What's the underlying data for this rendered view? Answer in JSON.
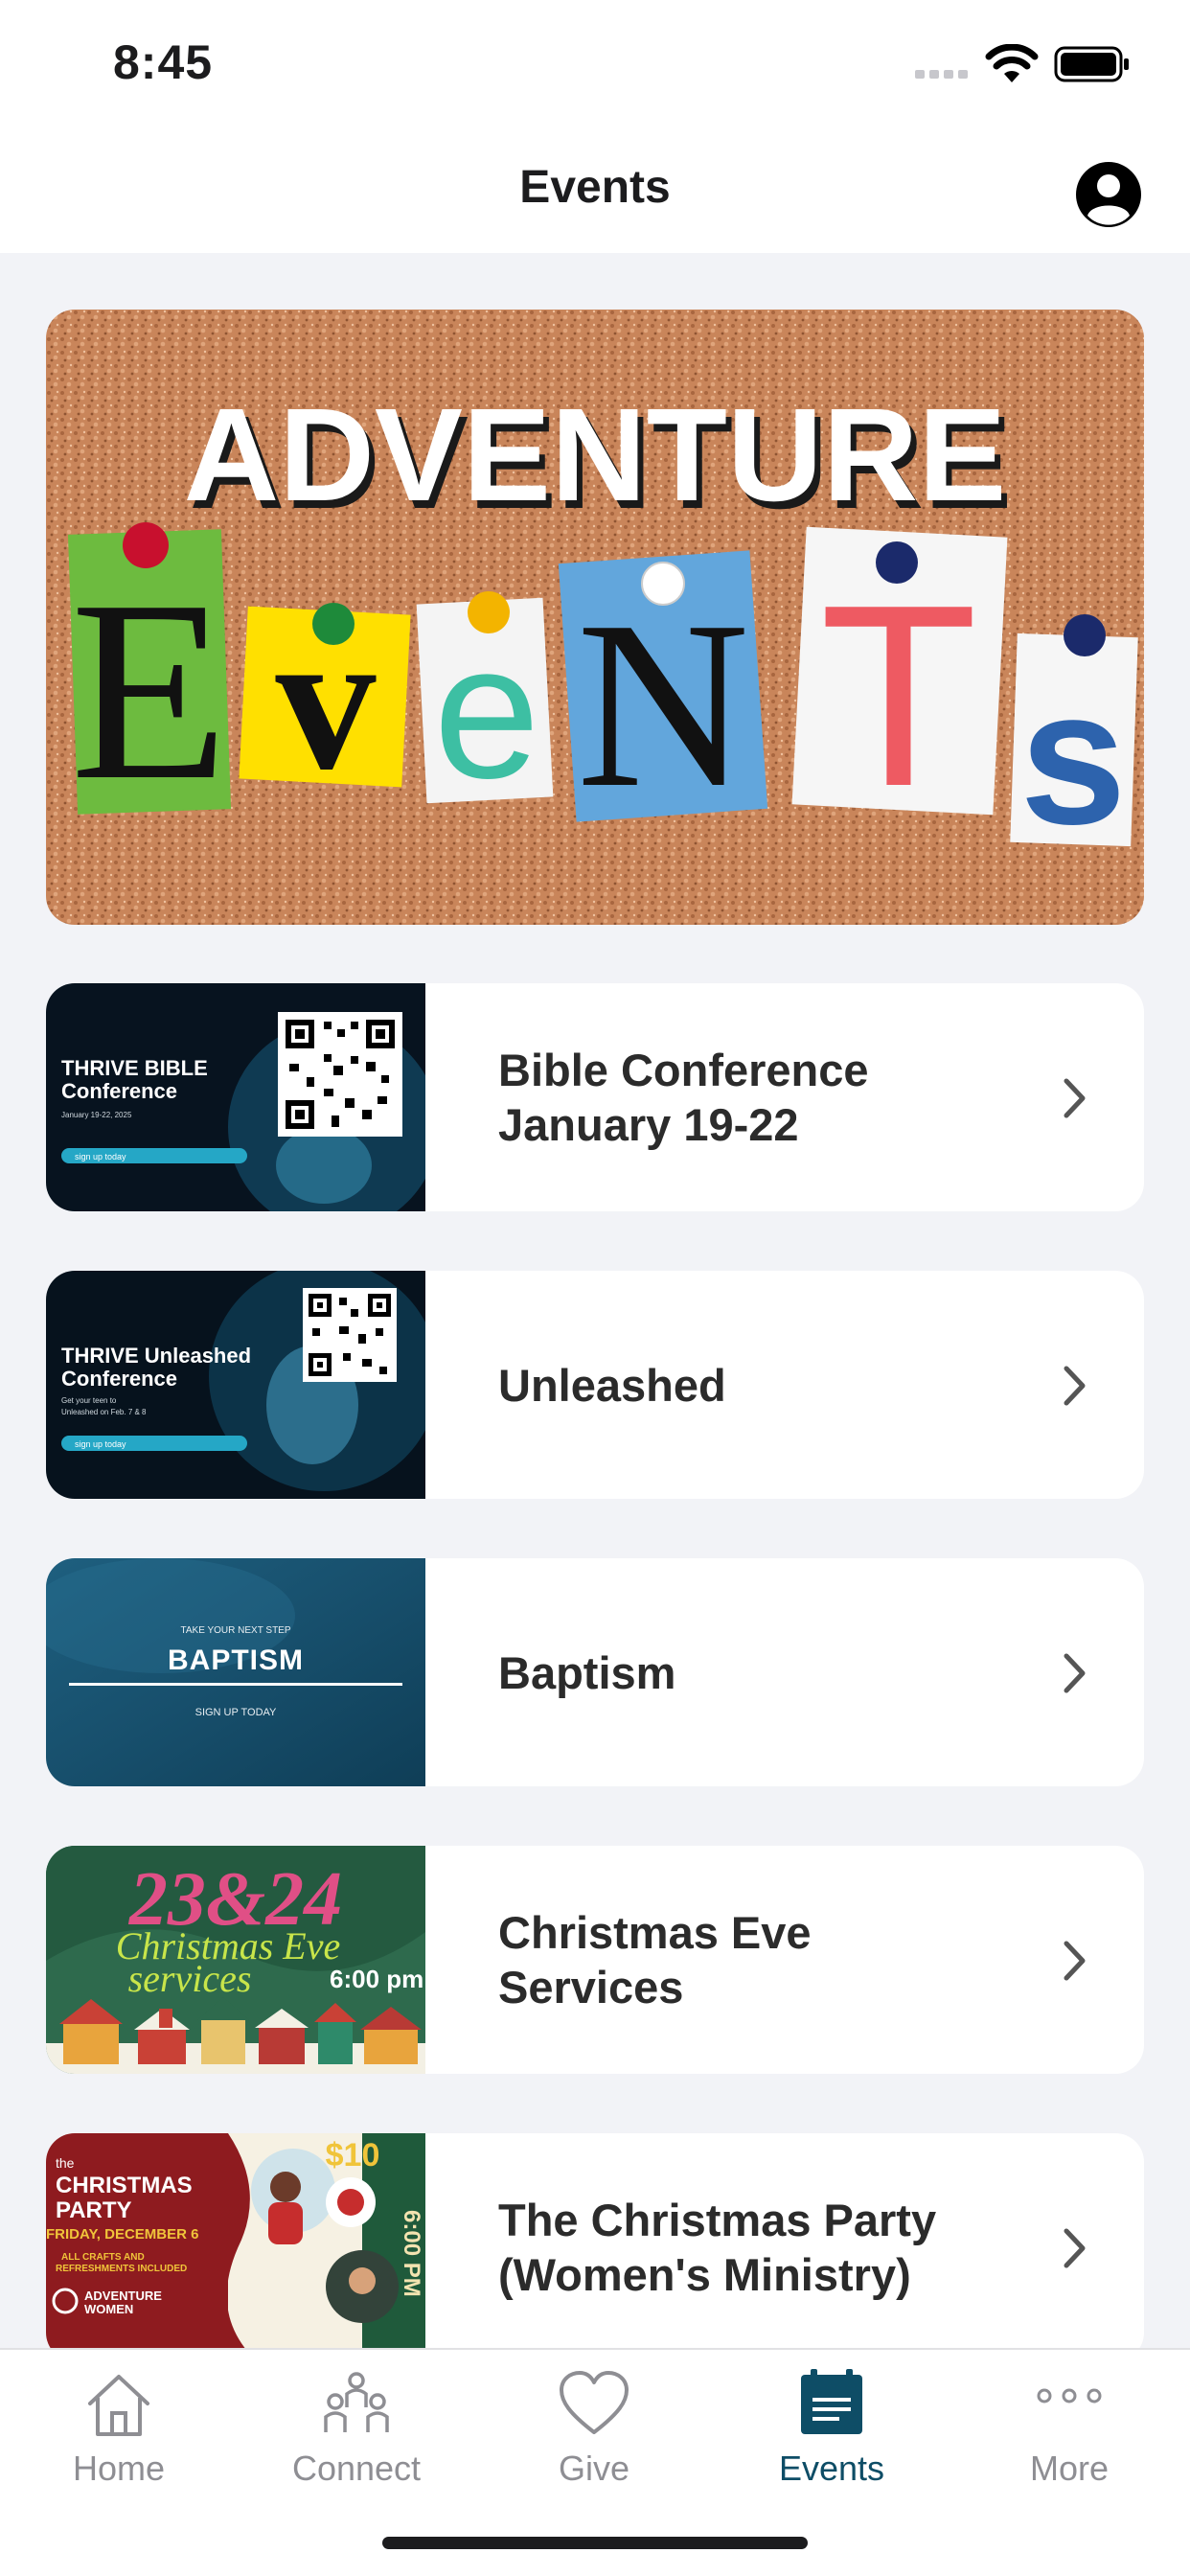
{
  "status_bar": {
    "time": "8:45",
    "icons": [
      "cellular-signal-icon",
      "wifi-icon",
      "battery-icon"
    ]
  },
  "nav": {
    "title": "Events",
    "profile_icon": "person-circle-icon"
  },
  "hero": {
    "line1": "ADVENTURE",
    "letters": [
      "E",
      "v",
      "e",
      "N",
      "T",
      "s"
    ]
  },
  "events": [
    {
      "title": "Bible Conference\nJanuary 19-22",
      "thumb": {
        "heading": "THRIVE BIBLE",
        "subheading": "Conference",
        "detail": "January 19-22, 2025",
        "cta": "sign up today"
      }
    },
    {
      "title": "Unleashed",
      "thumb": {
        "heading": "THRIVE Unleashed",
        "subheading": "Conference",
        "detail": "Get your teen to",
        "detail2": "Unleashed on Feb. 7 & 8",
        "cta": "sign up today"
      }
    },
    {
      "title": "Baptism",
      "thumb": {
        "kicker": "TAKE YOUR NEXT STEP",
        "heading": "BAPTISM",
        "cta": "SIGN UP TODAY"
      }
    },
    {
      "title": "Christmas Eve\nServices",
      "thumb": {
        "dates": "23&24",
        "line1": "Christmas Eve",
        "line2": "services",
        "time": "6:00 pm"
      }
    },
    {
      "title": "The Christmas Party\n(Women's Ministry)",
      "thumb": {
        "kicker": "the",
        "heading": "CHRISTMAS",
        "heading2": "PARTY",
        "date": "FRIDAY, DECEMBER 6",
        "note": "ALL CRAFTS AND",
        "note2": "REFRESHMENTS INCLUDED",
        "brand": "ADVENTURE",
        "brand2": "WOMEN",
        "price": "$10",
        "time": "6:00 PM"
      }
    }
  ],
  "tabs": [
    {
      "label": "Home",
      "icon": "house-icon",
      "active": false
    },
    {
      "label": "Connect",
      "icon": "people-icon",
      "active": false
    },
    {
      "label": "Give",
      "icon": "heart-icon",
      "active": false
    },
    {
      "label": "Events",
      "icon": "calendar-icon",
      "active": true
    },
    {
      "label": "More",
      "icon": "ellipsis-icon",
      "active": false
    }
  ],
  "colors": {
    "accent": "#0e4d66",
    "inactive": "#8e8e93",
    "background": "#f2f3f7"
  }
}
